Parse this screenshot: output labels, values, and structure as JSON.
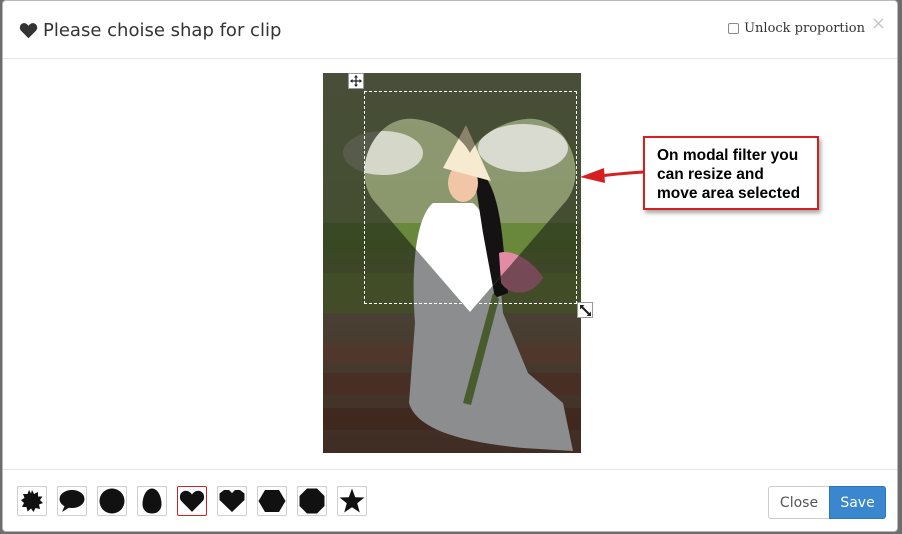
{
  "modal": {
    "title": "Please choise shap for clip",
    "title_icon": "heart-icon",
    "unlock_label": "Unlock proportion",
    "unlock_checked": false,
    "close_symbol": "×"
  },
  "editor": {
    "image": "photo of woman in conical hat with lotus flowers",
    "selected_shape": "heart",
    "move_icon": "move-icon",
    "resize_icon": "resize-icon"
  },
  "annotation": {
    "text": "On modal filter you can resize and move area selected",
    "color": "#d62020"
  },
  "shapes": [
    {
      "name": "starburst",
      "icon": "starburst-icon"
    },
    {
      "name": "speech-bubble",
      "icon": "speech-bubble-icon"
    },
    {
      "name": "circle",
      "icon": "circle-icon"
    },
    {
      "name": "egg",
      "icon": "egg-icon"
    },
    {
      "name": "heart",
      "icon": "heart-icon",
      "active": true
    },
    {
      "name": "heart-wide",
      "icon": "heart-wide-icon"
    },
    {
      "name": "hexagon",
      "icon": "hexagon-icon"
    },
    {
      "name": "octagon",
      "icon": "octagon-icon"
    },
    {
      "name": "star",
      "icon": "star-icon"
    }
  ],
  "footer": {
    "close_label": "Close",
    "save_label": "Save",
    "save_color": "#3a87cf"
  }
}
